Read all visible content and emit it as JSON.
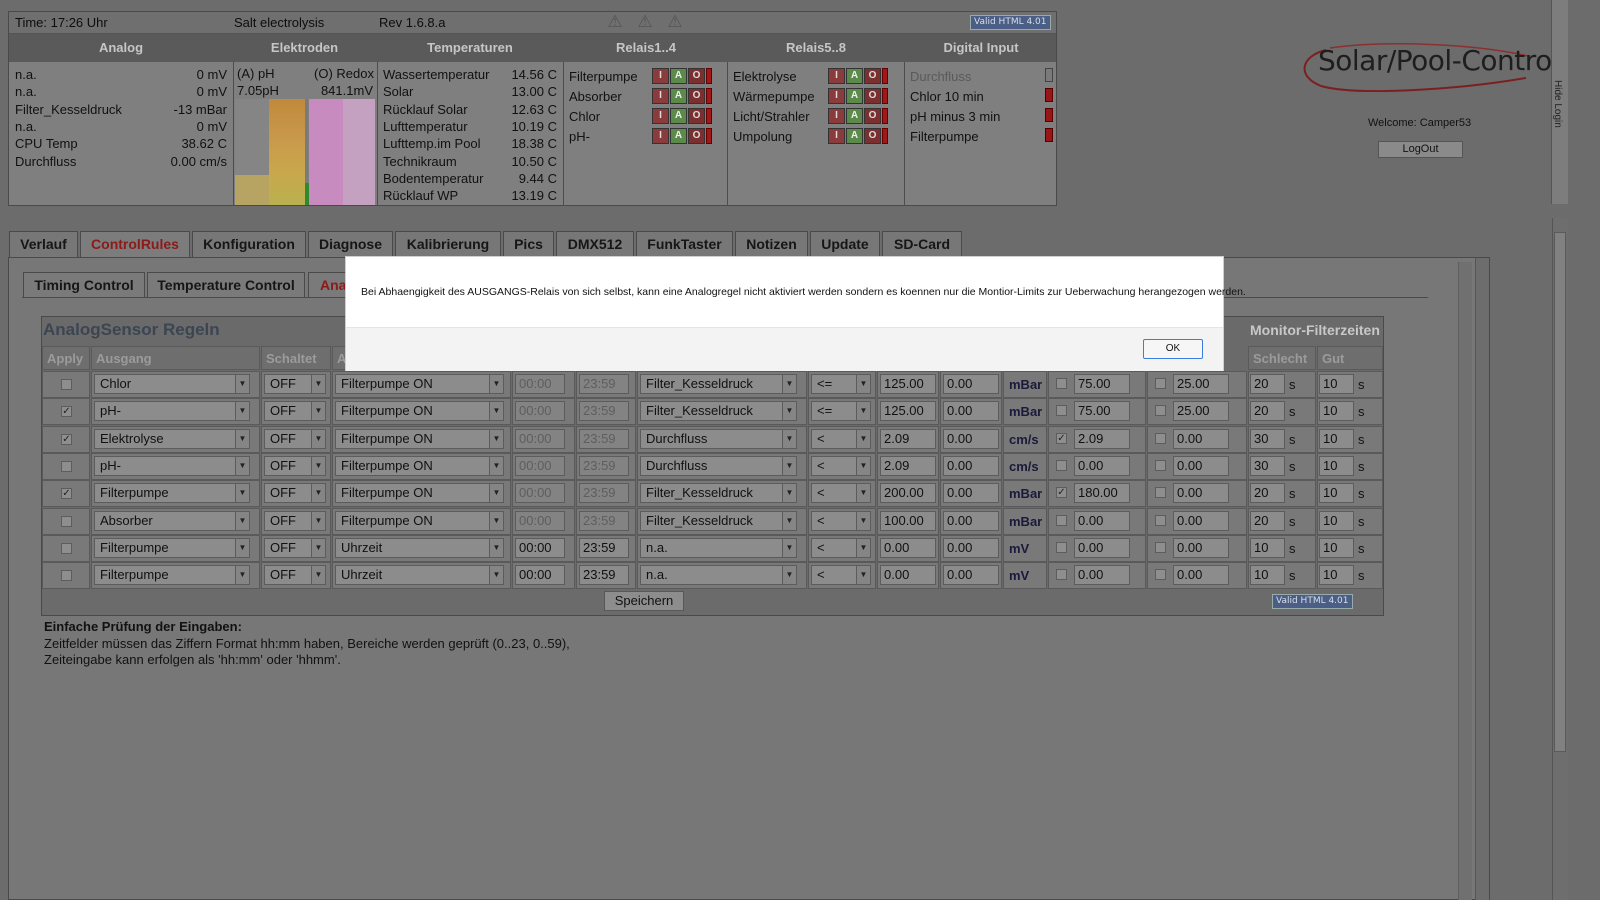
{
  "header": {
    "time": "Time: 17:26 Uhr",
    "mode": "Salt electrolysis",
    "rev": "Rev 1.6.8.a",
    "badge": "Valid HTML 4.01"
  },
  "sections": {
    "analog": "Analog",
    "elektroden": "Elektroden",
    "temperaturen": "Temperaturen",
    "relais14": "Relais1..4",
    "relais58": "Relais5..8",
    "digital": "Digital Input"
  },
  "analog": [
    {
      "label": "n.a.",
      "value": "0 mV"
    },
    {
      "label": "n.a.",
      "value": "0 mV"
    },
    {
      "label": "Filter_Kesseldruck",
      "value": "-13 mBar"
    },
    {
      "label": "n.a.",
      "value": "0 mV"
    },
    {
      "label": "CPU Temp",
      "value": "38.62 C"
    },
    {
      "label": "Durchfluss",
      "value": "0.00 cm/s"
    }
  ],
  "elektroden": {
    "ph_label": "(A) pH",
    "redox_label": "(O) Redox",
    "ph_value": "7.05pH",
    "redox_value": "841.1mV"
  },
  "temperaturen": [
    {
      "label": "Wassertemperatur",
      "value": "14.56 C"
    },
    {
      "label": "Solar",
      "value": "13.00 C"
    },
    {
      "label": "Rücklauf Solar",
      "value": "12.63 C"
    },
    {
      "label": "Lufttemperatur",
      "value": "10.19 C"
    },
    {
      "label": "Lufttemp.im Pool",
      "value": "18.38 C"
    },
    {
      "label": "Technikraum",
      "value": "10.50 C"
    },
    {
      "label": "Bodentemperatur",
      "value": "9.44 C"
    },
    {
      "label": "Rücklauf WP",
      "value": "13.19 C"
    }
  ],
  "relais14": [
    "Filterpumpe",
    "Absorber",
    "Chlor",
    "pH-"
  ],
  "relais58": [
    "Elektrolyse",
    "Wärmepumpe",
    "Licht/Strahler",
    "Umpolung"
  ],
  "relay_btn": {
    "i": "I",
    "a": "A",
    "o": "O"
  },
  "digital": [
    "Durchfluss",
    "Chlor 10 min",
    "pH minus 3 min",
    "Filterpumpe"
  ],
  "logo": "Solar/Pool-Control",
  "welcome": "Welcome:  Camper53",
  "logout": "LogOut",
  "hide_login": "Hide Login",
  "tabs": [
    "Verlauf",
    "ControlRules",
    "Konfiguration",
    "Diagnose",
    "Kalibrierung",
    "Pics",
    "DMX512",
    "FunkTaster",
    "Notizen",
    "Update",
    "SD-Card"
  ],
  "subtabs": [
    "Timing Control",
    "Temperature Control",
    "Ana"
  ],
  "table": {
    "title": "AnalogSensor Regeln",
    "monitor_title": "Monitor-Filterzeiten",
    "headers": {
      "apply": "Apply",
      "ausgang": "Ausgang",
      "schaltet": "Schaltet",
      "a": "A",
      "schlecht": "Schlecht",
      "gut": "Gut"
    },
    "rows": [
      {
        "apply": false,
        "ausgang": "Chlor",
        "schaltet": "OFF",
        "bedingung": "Filterpumpe ON",
        "von": "00:00",
        "bis": "23:59",
        "sensor": "Filter_Kesseldruck",
        "op": "<=",
        "wert": "125.00",
        "hyst": "0.00",
        "unit": "mBar",
        "m1_chk": false,
        "m1": "75.00",
        "m2_chk": false,
        "m2": "25.00",
        "schlecht": "20",
        "gut": "10",
        "s": "s",
        "time_dim": true
      },
      {
        "apply": true,
        "ausgang": "pH-",
        "schaltet": "OFF",
        "bedingung": "Filterpumpe ON",
        "von": "00:00",
        "bis": "23:59",
        "sensor": "Filter_Kesseldruck",
        "op": "<=",
        "wert": "125.00",
        "hyst": "0.00",
        "unit": "mBar",
        "m1_chk": false,
        "m1": "75.00",
        "m2_chk": false,
        "m2": "25.00",
        "schlecht": "20",
        "gut": "10",
        "s": "s",
        "time_dim": true
      },
      {
        "apply": true,
        "ausgang": "Elektrolyse",
        "schaltet": "OFF",
        "bedingung": "Filterpumpe ON",
        "von": "00:00",
        "bis": "23:59",
        "sensor": "Durchfluss",
        "op": "<",
        "wert": "2.09",
        "hyst": "0.00",
        "unit": "cm/s",
        "m1_chk": true,
        "m1": "2.09",
        "m2_chk": false,
        "m2": "0.00",
        "schlecht": "30",
        "gut": "10",
        "s": "s",
        "time_dim": true
      },
      {
        "apply": false,
        "ausgang": "pH-",
        "schaltet": "OFF",
        "bedingung": "Filterpumpe ON",
        "von": "00:00",
        "bis": "23:59",
        "sensor": "Durchfluss",
        "op": "<",
        "wert": "2.09",
        "hyst": "0.00",
        "unit": "cm/s",
        "m1_chk": false,
        "m1": "0.00",
        "m2_chk": false,
        "m2": "0.00",
        "schlecht": "30",
        "gut": "10",
        "s": "s",
        "time_dim": true
      },
      {
        "apply": true,
        "ausgang": "Filterpumpe",
        "schaltet": "OFF",
        "bedingung": "Filterpumpe ON",
        "von": "00:00",
        "bis": "23:59",
        "sensor": "Filter_Kesseldruck",
        "op": "<",
        "wert": "200.00",
        "hyst": "0.00",
        "unit": "mBar",
        "m1_chk": true,
        "m1": "180.00",
        "m2_chk": false,
        "m2": "0.00",
        "schlecht": "20",
        "gut": "10",
        "s": "s",
        "time_dim": true
      },
      {
        "apply": false,
        "ausgang": "Absorber",
        "schaltet": "OFF",
        "bedingung": "Filterpumpe ON",
        "von": "00:00",
        "bis": "23:59",
        "sensor": "Filter_Kesseldruck",
        "op": "<",
        "wert": "100.00",
        "hyst": "0.00",
        "unit": "mBar",
        "m1_chk": false,
        "m1": "0.00",
        "m2_chk": false,
        "m2": "0.00",
        "schlecht": "20",
        "gut": "10",
        "s": "s",
        "time_dim": true
      },
      {
        "apply": false,
        "ausgang": "Filterpumpe",
        "schaltet": "OFF",
        "bedingung": "Uhrzeit",
        "von": "00:00",
        "bis": "23:59",
        "sensor": "n.a.",
        "op": "<",
        "wert": "0.00",
        "hyst": "0.00",
        "unit": "mV",
        "m1_chk": false,
        "m1": "0.00",
        "m2_chk": false,
        "m2": "0.00",
        "schlecht": "10",
        "gut": "10",
        "s": "s",
        "time_dim": false
      },
      {
        "apply": false,
        "ausgang": "Filterpumpe",
        "schaltet": "OFF",
        "bedingung": "Uhrzeit",
        "von": "00:00",
        "bis": "23:59",
        "sensor": "n.a.",
        "op": "<",
        "wert": "0.00",
        "hyst": "0.00",
        "unit": "mV",
        "m1_chk": false,
        "m1": "0.00",
        "m2_chk": false,
        "m2": "0.00",
        "schlecht": "10",
        "gut": "10",
        "s": "s",
        "time_dim": false
      }
    ],
    "save": "Speichern"
  },
  "hint": {
    "title": "Einfache Prüfung der Eingaben:",
    "line1": "Zeitfelder müssen das Ziffern Format hh:mm haben, Bereiche werden geprüft (0..23, 0..59),",
    "line2": "Zeiteingabe kann erfolgen als 'hh:mm' oder 'hhmm'."
  },
  "modal": {
    "message": "Bei Abhaengigkeit des AUSGANGS-Relais von sich selbst, kann eine Analogregel nicht aktiviert werden sondern es koennen nur die Montior-Limits zur Ueberwachung herangezogen werden.",
    "ok": "OK"
  },
  "colors": {
    "overlay": "#6c6c6c",
    "accent_tab": "#8b1a1a",
    "ph_bar": "#c9a04a",
    "redox_bar": "#d29acb"
  }
}
